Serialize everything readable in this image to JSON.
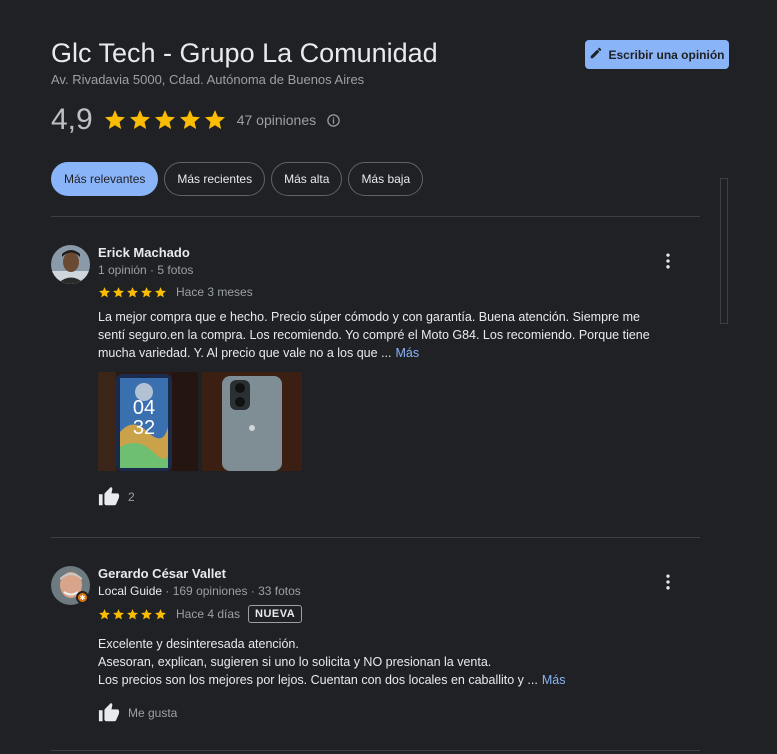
{
  "header": {
    "title": "Glc Tech - Grupo La Comunidad",
    "address": "Av. Rivadavia 5000, Cdad. Autónoma de Buenos Aires",
    "write_button": "Escribir una opinión",
    "rating": "4,9",
    "stars": 5,
    "review_count": "47 opiniones"
  },
  "sort_chips": [
    {
      "label": "Más relevantes",
      "active": true
    },
    {
      "label": "Más recientes",
      "active": false
    },
    {
      "label": "Más alta",
      "active": false
    },
    {
      "label": "Más baja",
      "active": false
    }
  ],
  "reviews": [
    {
      "name": "Erick Machado",
      "meta": "1 opinión · 5 fotos",
      "stars": 5,
      "when": "Hace 3 meses",
      "text_lines": [
        "La mejor compra que e hecho. Precio súper cómodo y  con garantía. Buena atención.  Siempre me",
        "sentí seguro.en la compra.  Los recomiendo. Yo compré el Moto G84. Los recomiendo. Porque tiene",
        "mucha variedad. Y. Al precio que vale no a los que ..."
      ],
      "more": "Más",
      "likes": "2",
      "photo_text": {
        "hour": "04",
        "minute": "32"
      }
    },
    {
      "name": "Gerardo César Vallet",
      "guide": "Local Guide",
      "meta": " · 169 opiniones · 33 fotos",
      "stars": 5,
      "when": "Hace 4 días",
      "badge": "NUEVA",
      "text_lines": [
        "Excelente y desinteresada atención.",
        "Asesoran, explican, sugieren si uno lo solicita y NO presionan la venta.",
        "Los precios son los mejores por lejos. Cuentan con dos locales en caballito y ..."
      ],
      "more": "Más",
      "likes": "Me gusta"
    }
  ],
  "colors": {
    "background": "#202124",
    "accent": "#8ab4f8",
    "star": "#fbbc04",
    "muted": "#9aa0a6"
  },
  "icons": [
    "pencil-icon",
    "star-icon",
    "info-icon",
    "more-vert-icon",
    "thumb-up-icon",
    "local-guide-badge-icon"
  ]
}
